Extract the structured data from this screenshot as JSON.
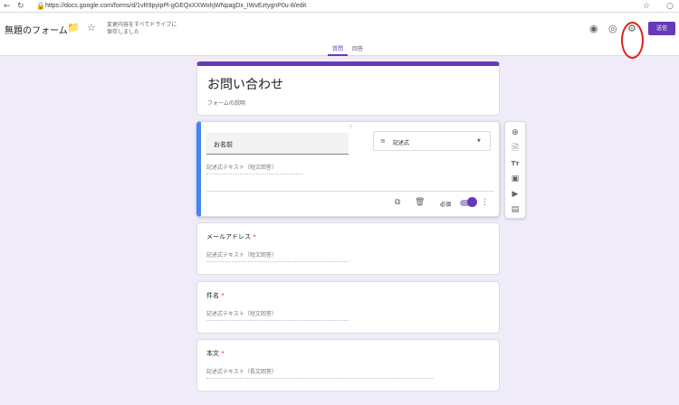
{
  "browser": {
    "reload_icon": "reload-icon",
    "lock_icon": "lock-icon",
    "url": "https://docs.google.com/forms/d/1vR9pyipPl-gGEQxXXWohjWNpagDx_IWvEztygnP0u-8/edit",
    "bookmark_icon": "star-icon"
  },
  "header": {
    "form_title": "無題のフォーム",
    "folder_icon": "folder-icon",
    "star_icon": "star-icon",
    "save_status": "変更内容をすべてドライブに保存しました",
    "palette_icon": "palette-icon",
    "preview_icon": "eye-icon",
    "settings_icon": "gear-icon",
    "send_label": "送信",
    "tabs": [
      {
        "label": "質問",
        "active": true
      },
      {
        "label": "回答",
        "active": false
      }
    ]
  },
  "form": {
    "title": "お問い合わせ",
    "description": "フォームの説明",
    "active_question": {
      "title": "お名前",
      "type_label": "記述式",
      "answer_hint": "記述式テキスト（短文回答）",
      "required_label": "必須",
      "required": true
    },
    "questions": [
      {
        "title": "メールアドレス",
        "required_mark": "*",
        "answer_hint": "記述式テキスト（短文回答）"
      },
      {
        "title": "件名",
        "required_mark": "*",
        "answer_hint": "記述式テキスト（短文回答）"
      },
      {
        "title": "本文",
        "required_mark": "*",
        "answer_hint": "記述式テキスト（長文回答）"
      }
    ]
  },
  "side_toolbar": {
    "icons": [
      "add-question-icon",
      "import-questions-icon",
      "add-title-icon",
      "add-image-icon",
      "add-video-icon",
      "add-section-icon"
    ]
  },
  "colors": {
    "accent": "#673ab7",
    "background": "#f0ebf8",
    "active_border": "#4285f4",
    "highlight_circle": "#e0201b"
  }
}
